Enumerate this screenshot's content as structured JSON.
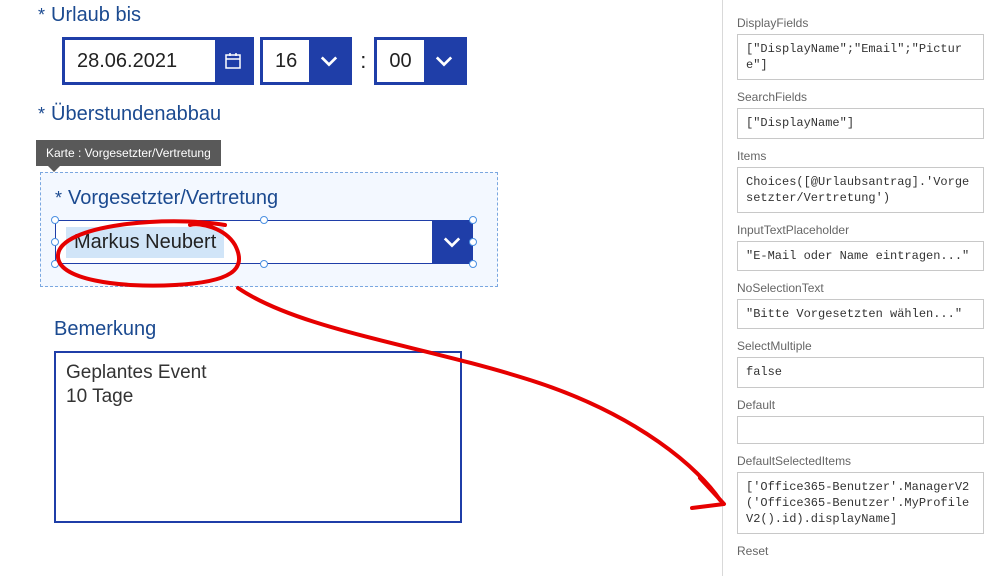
{
  "form": {
    "urlaub_bis_label": "Urlaub bis",
    "date_value": "28.06.2021",
    "hour_value": "16",
    "minute_value": "00",
    "uberstunden_label": "Überstundenabbau",
    "tooltip_text": "Karte : Vorgesetzter/Vertretung",
    "vorgesetzter_label": "Vorgesetzter/Vertretung",
    "selected_person": "Markus Neubert",
    "remark_label": "Bemerkung",
    "remark_text": "Geplantes Event\n10 Tage"
  },
  "props": {
    "displayfields_label": "DisplayFields",
    "displayfields_value": "[\"DisplayName\";\"Email\";\"Picture\"]",
    "searchfields_label": "SearchFields",
    "searchfields_value": "[\"DisplayName\"]",
    "items_label": "Items",
    "items_value": "Choices([@Urlaubsantrag].'Vorgesetzter/Vertretung')",
    "inputtextplaceholder_label": "InputTextPlaceholder",
    "inputtextplaceholder_value": "\"E-Mail oder Name eintragen...\"",
    "noselectiontext_label": "NoSelectionText",
    "noselectiontext_value": "\"Bitte Vorgesetzten wählen...\"",
    "selectmultiple_label": "SelectMultiple",
    "selectmultiple_value": "false",
    "default_label": "Default",
    "default_value": "",
    "defaultselecteditems_label": "DefaultSelectedItems",
    "defaultselecteditems_value": "['Office365-Benutzer'.ManagerV2('Office365-Benutzer'.MyProfileV2().id).displayName]",
    "reset_label": "Reset"
  }
}
